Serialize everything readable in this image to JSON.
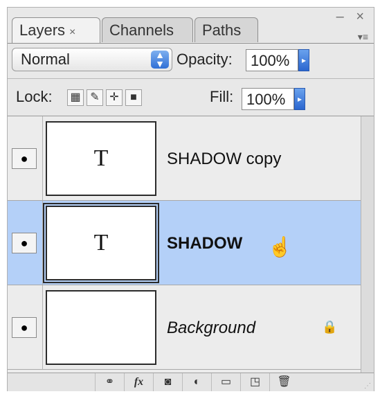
{
  "window": {
    "controls": "– ×",
    "menu_icon": "▾≡"
  },
  "tabs": [
    {
      "label": "Layers",
      "close": "×",
      "active": true
    },
    {
      "label": "Channels",
      "active": false
    },
    {
      "label": "Paths",
      "active": false
    }
  ],
  "blend_mode": {
    "value": "Normal",
    "stepper": "⬍"
  },
  "opacity": {
    "label": "Opacity:",
    "value": "100%"
  },
  "lock": {
    "label": "Lock:",
    "icons": [
      "lock-transparent-icon",
      "lock-image-icon",
      "lock-position-icon",
      "lock-all-icon"
    ]
  },
  "fill": {
    "label": "Fill:",
    "value": "100%"
  },
  "layers": [
    {
      "name": "SHADOW copy",
      "thumb": "T",
      "selected": false,
      "style": "normal",
      "locked": false
    },
    {
      "name": "SHADOW",
      "thumb": "T",
      "selected": true,
      "style": "bold",
      "locked": false
    },
    {
      "name": "Background",
      "thumb": "",
      "selected": false,
      "style": "italic",
      "locked": true
    }
  ],
  "bottom_buttons": [
    "link-layers-icon",
    "fx-icon",
    "layer-mask-icon",
    "adjustment-layer-icon",
    "new-group-icon",
    "new-layer-icon",
    "trash-icon"
  ],
  "bottom_labels": {
    "fx": "fx"
  },
  "colors": {
    "selection": "#b4d0f8",
    "accent": "#2f6fd6"
  }
}
